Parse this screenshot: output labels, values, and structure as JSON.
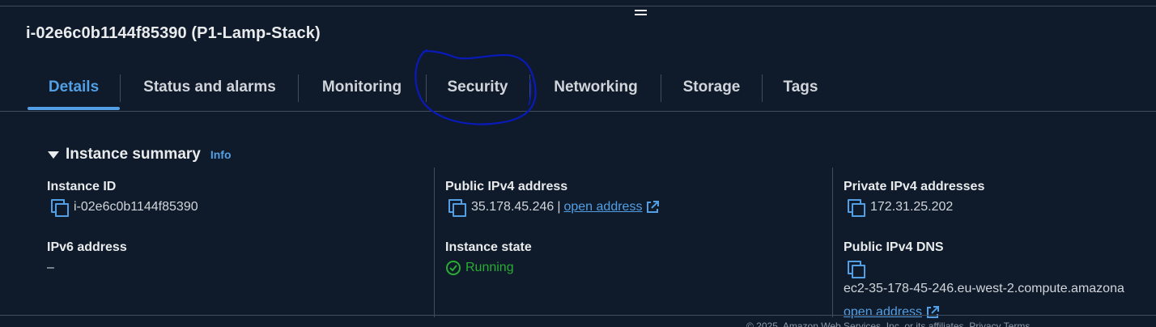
{
  "instance": {
    "title": "i-02e6c0b1144f85390 (P1-Lamp-Stack)"
  },
  "tabs": [
    {
      "label": "Details",
      "active": true
    },
    {
      "label": "Status and alarms",
      "active": false
    },
    {
      "label": "Monitoring",
      "active": false
    },
    {
      "label": "Security",
      "active": false
    },
    {
      "label": "Networking",
      "active": false
    },
    {
      "label": "Storage",
      "active": false
    },
    {
      "label": "Tags",
      "active": false
    }
  ],
  "summary": {
    "title": "Instance summary",
    "info_label": "Info",
    "instance_id_label": "Instance ID",
    "instance_id_value": "i-02e6c0b1144f85390",
    "ipv6_label": "IPv6 address",
    "ipv6_value": "–",
    "public_ipv4_label": "Public IPv4 address",
    "public_ipv4_value": "35.178.45.246",
    "public_ipv4_sep": "|",
    "open_address_label": "open address",
    "instance_state_label": "Instance state",
    "instance_state_value": "Running",
    "private_ipv4_label": "Private IPv4 addresses",
    "private_ipv4_value": "172.31.25.202",
    "public_dns_label": "Public IPv4 DNS",
    "public_dns_value": "ec2-35-178-45-246.eu-west-2.compute.amazona",
    "dns_open_address_label": "open address"
  },
  "footer": {
    "text": "© 2025, Amazon Web Services, Inc. or its affiliates.   Privacy   Terms"
  },
  "colors": {
    "accent": "#539fe5",
    "running": "#29ad32",
    "annotation": "#0a1ab8",
    "background": "#0f1b2a"
  },
  "icons": [
    "drag-handle-icon",
    "caret-down-icon",
    "copy-icon",
    "external-link-icon",
    "check-circle-icon"
  ]
}
